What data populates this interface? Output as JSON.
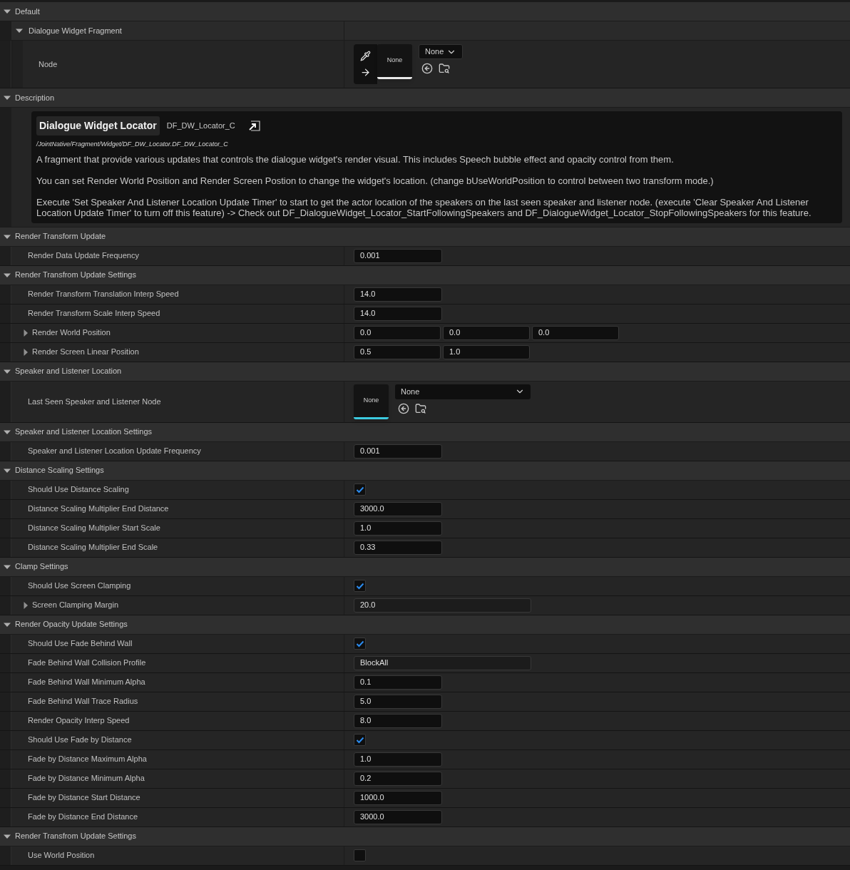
{
  "sections": [
    {
      "title": "Default",
      "expanded": true,
      "rows": [
        {
          "kind": "group",
          "label": "Dialogue Widget Fragment",
          "expanded": true,
          "children": [
            {
              "kind": "node_picker",
              "label": "Node",
              "thumbnail": "None",
              "dropdown": "None"
            }
          ]
        }
      ]
    },
    {
      "title": "Description",
      "expanded": true,
      "rows": [
        {
          "kind": "description",
          "title": "Dialogue Widget Locator",
          "class_name": "DF_DW_Locator_C",
          "path": "/JointNative/Fragment/Widget/DF_DW_Locator.DF_DW_Locator_C",
          "paragraphs": [
            "A fragment that provide various updates that controls the dialogue widget's render visual. This includes Speech bubble effect and opacity control from them.",
            "You can set Render World Position and Render Screen Postion to change the widget's location. (change bUseWorldPosition to control between two transform mode.)",
            "Execute 'Set Speaker And Listener Location Update Timer' to start to get the actor location of the speakers on the last seen speaker and listener node. (execute 'Clear Speaker And Listener Location Update Timer' to turn off this feature) -> Check out  DF_DialogueWidget_Locator_StartFollowingSpeakers and DF_DialogueWidget_Locator_StopFollowingSpeakers for this feature."
          ]
        }
      ]
    },
    {
      "title": "Render Transform Update",
      "expanded": true,
      "rows": [
        {
          "kind": "number",
          "label": "Render Data Update Frequency",
          "values": [
            "0.001"
          ]
        }
      ]
    },
    {
      "title": "Render Transfrom Update Settings",
      "expanded": true,
      "rows": [
        {
          "kind": "number",
          "label": "Render Transform Translation Interp Speed",
          "values": [
            "14.0"
          ]
        },
        {
          "kind": "number",
          "label": "Render Transform Scale Interp Speed",
          "values": [
            "14.0"
          ]
        },
        {
          "kind": "struct",
          "label": "Render World Position",
          "expanded": false,
          "values": [
            "0.0",
            "0.0",
            "0.0"
          ]
        },
        {
          "kind": "struct",
          "label": "Render Screen Linear Position",
          "expanded": false,
          "values": [
            "0.5",
            "1.0"
          ]
        }
      ]
    },
    {
      "title": "Speaker and Listener Location",
      "expanded": true,
      "rows": [
        {
          "kind": "asset",
          "label": "Last Seen Speaker and Listener Node",
          "thumbnail": "None",
          "dropdown": "None"
        }
      ]
    },
    {
      "title": "Speaker and Listener Location Settings",
      "expanded": true,
      "rows": [
        {
          "kind": "number",
          "label": "Speaker and Listener Location Update Frequency",
          "values": [
            "0.001"
          ]
        }
      ]
    },
    {
      "title": "Distance Scaling Settings",
      "expanded": true,
      "rows": [
        {
          "kind": "checkbox",
          "label": "Should Use Distance Scaling",
          "checked": true
        },
        {
          "kind": "number",
          "label": "Distance Scaling Multiplier End Distance",
          "values": [
            "3000.0"
          ]
        },
        {
          "kind": "number",
          "label": "Distance Scaling Multiplier Start Scale",
          "values": [
            "1.0"
          ]
        },
        {
          "kind": "number",
          "label": "Distance Scaling Multiplier End Scale",
          "values": [
            "0.33"
          ]
        }
      ]
    },
    {
      "title": "Clamp Settings",
      "expanded": true,
      "rows": [
        {
          "kind": "checkbox",
          "label": "Should Use Screen Clamping",
          "checked": true
        },
        {
          "kind": "struct",
          "label": "Screen Clamping Margin",
          "expanded": false,
          "values": [
            "20.0"
          ]
        }
      ]
    },
    {
      "title": "Render Opacity Update Settings",
      "expanded": true,
      "rows": [
        {
          "kind": "checkbox",
          "label": "Should Use Fade Behind Wall",
          "checked": true
        },
        {
          "kind": "text",
          "label": "Fade Behind Wall Collision Profile",
          "value": "BlockAll"
        },
        {
          "kind": "number",
          "label": "Fade Behind Wall Minimum Alpha",
          "values": [
            "0.1"
          ]
        },
        {
          "kind": "number",
          "label": "Fade Behind Wall Trace Radius",
          "values": [
            "5.0"
          ]
        },
        {
          "kind": "number",
          "label": "Render Opacity Interp Speed",
          "values": [
            "8.0"
          ]
        },
        {
          "kind": "checkbox",
          "label": "Should Use Fade by Distance",
          "checked": true
        },
        {
          "kind": "number",
          "label": "Fade by Distance Maximum Alpha",
          "values": [
            "1.0"
          ]
        },
        {
          "kind": "number",
          "label": "Fade by Distance Minimum Alpha",
          "values": [
            "0.2"
          ]
        },
        {
          "kind": "number",
          "label": "Fade by Distance Start Distance",
          "values": [
            "1000.0"
          ]
        },
        {
          "kind": "number",
          "label": "Fade by Distance End Distance",
          "values": [
            "3000.0"
          ]
        }
      ]
    },
    {
      "title": "Render Transfrom Update Settings",
      "expanded": true,
      "rows": [
        {
          "kind": "checkbox",
          "label": "Use World Position",
          "checked": false
        }
      ]
    }
  ]
}
